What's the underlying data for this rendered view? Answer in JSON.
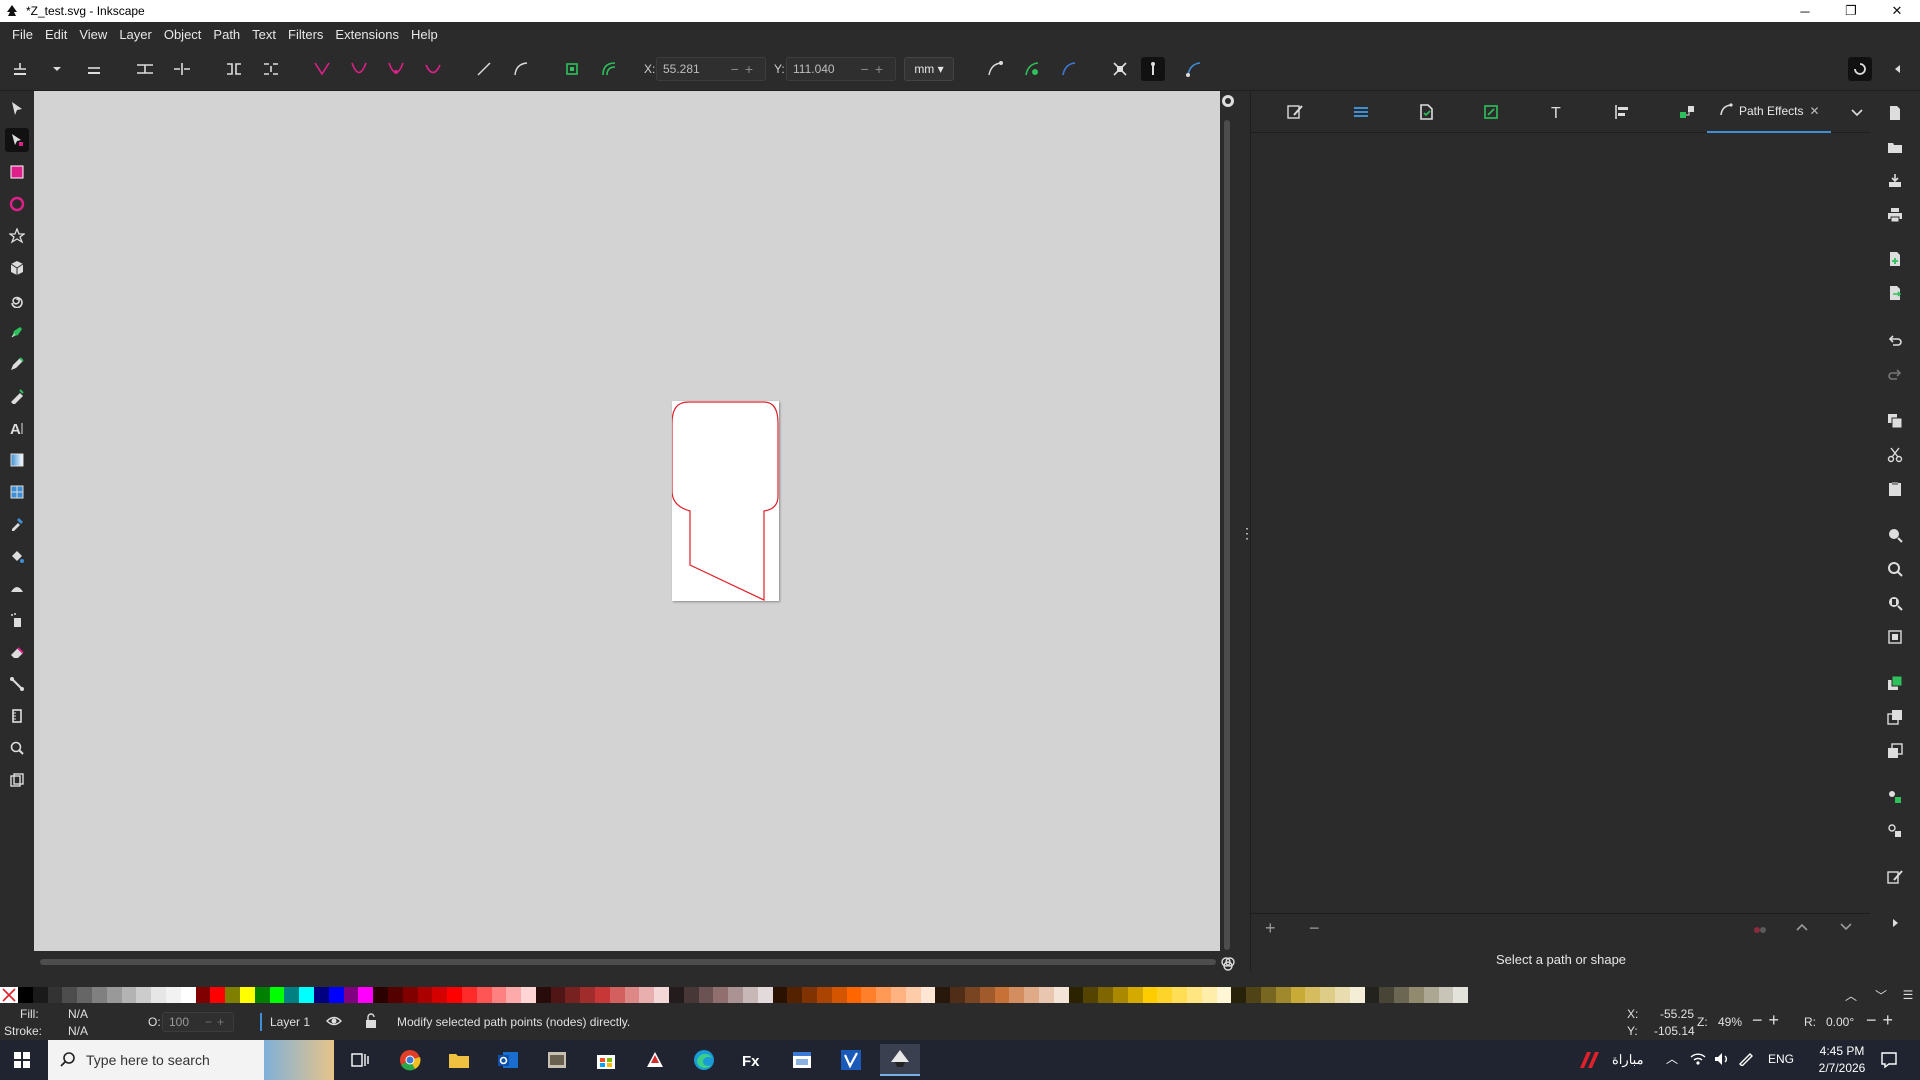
{
  "window": {
    "title": "*Z_test.svg - Inkscape",
    "minimize": "─",
    "maximize": "❐",
    "close": "✕"
  },
  "menu": [
    "File",
    "Edit",
    "View",
    "Layer",
    "Object",
    "Path",
    "Text",
    "Filters",
    "Extensions",
    "Help"
  ],
  "toolbar": {
    "x_label": "X:",
    "x_value": "55.281",
    "y_label": "Y:",
    "y_value": "111.040",
    "unit": "mm"
  },
  "tools": [
    "selector-tool",
    "node-tool",
    "rectangle-tool",
    "ellipse-tool",
    "star-tool",
    "3d-box-tool",
    "spiral-tool",
    "pen-tool",
    "pencil-tool",
    "calligraphy-tool",
    "text-tool",
    "gradient-tool",
    "mesh-tool",
    "dropper-tool",
    "paint-bucket-tool",
    "tweak-tool",
    "spray-tool",
    "eraser-tool",
    "connector-tool",
    "measure-tool",
    "zoom-tool",
    "pages-tool"
  ],
  "dock": {
    "active_tab": "Path Effects",
    "hint": "Select a path or shape",
    "add": "+",
    "remove": "−"
  },
  "status": {
    "fill_label": "Fill:",
    "fill_value": "N/A",
    "stroke_label": "Stroke:",
    "stroke_value": "N/A",
    "opacity_label": "O:",
    "opacity_value": "100",
    "layer": "Layer 1",
    "message": "Modify selected path points (nodes) directly.",
    "cursor_x_label": "X:",
    "cursor_x": "-55.25",
    "cursor_y_label": "Y:",
    "cursor_y": "-105.14",
    "zoom_label": "Z:",
    "zoom": "49%",
    "rotation_label": "R:",
    "rotation": "0.00°"
  },
  "taskbar": {
    "search_placeholder": "Type here to search",
    "weather_text": "مباراة",
    "language": "ENG",
    "time": "4:45 PM",
    "date": "2/7/2026"
  },
  "colors": {
    "accent": "#3d8fd6",
    "path_stroke": "#e0202a",
    "canvas": "#d3d3d3"
  }
}
